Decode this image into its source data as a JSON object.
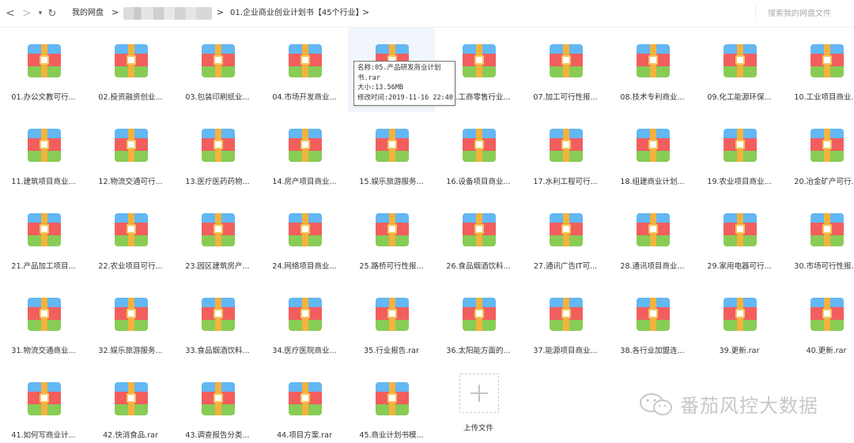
{
  "header": {
    "root_crumb": "我的网盘",
    "current_crumb": "01.企业商业创业计划书【45个行业】",
    "search_placeholder": "搜索我的网盘文件",
    "back_glyph": "<",
    "forward_glyph": ">",
    "dropdown_glyph": "▾",
    "refresh_glyph": "↻",
    "separator": ">"
  },
  "files": [
    {
      "name": "01.办公文教可行..."
    },
    {
      "name": "02.投资融资创业..."
    },
    {
      "name": "03.包装印刷纸业..."
    },
    {
      "name": "04.市场开发商业..."
    },
    {
      "name": "05.产品研发商业..."
    },
    {
      "name": "06.工商零售行业..."
    },
    {
      "name": "07.加工可行性报..."
    },
    {
      "name": "08.技术专利商业..."
    },
    {
      "name": "09.化工能源环保..."
    },
    {
      "name": "10.工业项目商业..."
    },
    {
      "name": "11.建筑项目商业..."
    },
    {
      "name": "12.物流交通可行..."
    },
    {
      "name": "13.医疗医药药物..."
    },
    {
      "name": "14.房产项目商业..."
    },
    {
      "name": "15.娱乐旅游服务..."
    },
    {
      "name": "16.设备项目商业..."
    },
    {
      "name": "17.水利工程可行..."
    },
    {
      "name": "18.组建商业计划..."
    },
    {
      "name": "19.农业项目商业..."
    },
    {
      "name": "20.冶金矿产可行..."
    },
    {
      "name": "21.产品加工项目..."
    },
    {
      "name": "22.农业项目可行..."
    },
    {
      "name": "23.园区建筑房产..."
    },
    {
      "name": "24.网络项目商业..."
    },
    {
      "name": "25.路桥可行性报..."
    },
    {
      "name": "26.食品烟酒饮料..."
    },
    {
      "name": "27.通讯广告IT可..."
    },
    {
      "name": "28.通讯项目商业..."
    },
    {
      "name": "29.家用电器可行..."
    },
    {
      "name": "30.市场可行性报..."
    },
    {
      "name": "31.物流交通商业..."
    },
    {
      "name": "32.娱乐旅游服务..."
    },
    {
      "name": "33.食品烟酒饮料..."
    },
    {
      "name": "34.医疗医院商业..."
    },
    {
      "name": "35.行业报告.rar"
    },
    {
      "name": "36.太阳能方面的..."
    },
    {
      "name": "37.能源项目商业..."
    },
    {
      "name": "38.各行业加盟连..."
    },
    {
      "name": "39.更新.rar"
    },
    {
      "name": "40.更新.rar"
    },
    {
      "name": "41.如何写商业计..."
    },
    {
      "name": "42.快消食品.rar"
    },
    {
      "name": "43.调查报告分类..."
    },
    {
      "name": "44.项目方案.rar"
    },
    {
      "name": "45.商业计划书模..."
    }
  ],
  "upload": {
    "label": "上传文件"
  },
  "tooltip": {
    "line1": "名称:05.产品研发商业计划",
    "line2": "书.rar",
    "line3": "大小:13.56MB",
    "line4": "修改时间:2019-11-16 22:40"
  },
  "watermark": {
    "text": "番茄风控大数据"
  },
  "colors": {
    "rar_top": "#63b7f2",
    "rar_mid": "#f25e5e",
    "rar_bottom": "#88cc55",
    "rar_strap": "#f3b33d",
    "hover_bg": "#f1f6fd"
  }
}
